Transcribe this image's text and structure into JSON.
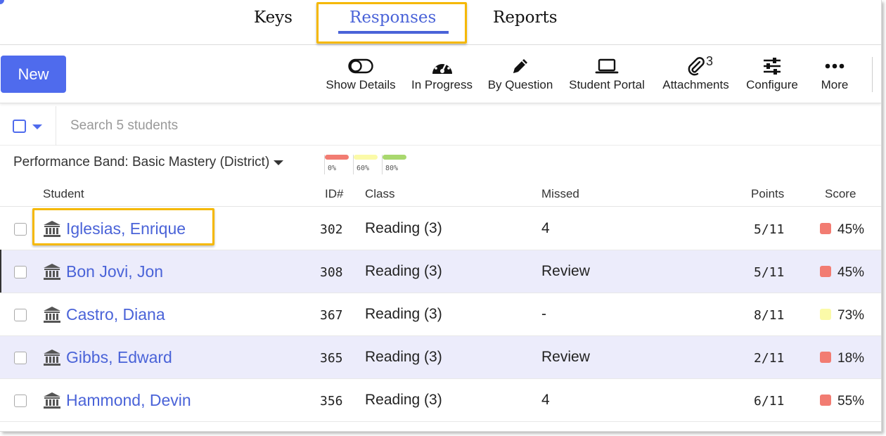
{
  "tabs": [
    {
      "label": "Keys"
    },
    {
      "label": "Responses",
      "active": true
    },
    {
      "label": "Reports"
    }
  ],
  "toolbar": {
    "new_label": "New",
    "tools": [
      {
        "label": "Show Details",
        "icon": "toggle-icon"
      },
      {
        "label": "In Progress",
        "icon": "speedometer-icon"
      },
      {
        "label": "By Question",
        "icon": "pencil-icon"
      },
      {
        "label": "Student Portal",
        "icon": "laptop-icon"
      },
      {
        "label": "Attachments",
        "icon": "paperclip-icon",
        "count": "3"
      },
      {
        "label": "Configure",
        "icon": "sliders-icon"
      },
      {
        "label": "More",
        "icon": "more-dots-icon"
      }
    ]
  },
  "search": {
    "placeholder": "Search 5 students"
  },
  "band": {
    "label": "Performance Band: Basic Mastery (District)",
    "levels": [
      {
        "label": "0%",
        "color": "#f27c72"
      },
      {
        "label": "60%",
        "color": "#fbfaa8"
      },
      {
        "label": "80%",
        "color": "#a9d86e"
      }
    ]
  },
  "table": {
    "headers": {
      "student": "Student",
      "id": "ID#",
      "class": "Class",
      "missed": "Missed",
      "points": "Points",
      "score": "Score"
    },
    "rows": [
      {
        "name": "Iglesias, Enrique",
        "id": "302",
        "class": "Reading (3)",
        "missed": "4",
        "points": "5/11",
        "score": "45%",
        "color": "#f27c72"
      },
      {
        "name": "Bon Jovi, Jon",
        "id": "308",
        "class": "Reading (3)",
        "missed": "Review",
        "points": "5/11",
        "score": "45%",
        "color": "#f27c72"
      },
      {
        "name": "Castro, Diana",
        "id": "367",
        "class": "Reading (3)",
        "missed": "-",
        "points": "8/11",
        "score": "73%",
        "color": "#fbfaa8"
      },
      {
        "name": "Gibbs, Edward",
        "id": "365",
        "class": "Reading (3)",
        "missed": "Review",
        "points": "2/11",
        "score": "18%",
        "color": "#f27c72"
      },
      {
        "name": "Hammond, Devin",
        "id": "356",
        "class": "Reading (3)",
        "missed": "4",
        "points": "6/11",
        "score": "55%",
        "color": "#f27c72"
      }
    ]
  },
  "colors": {
    "accent": "#4f6bed",
    "highlight": "#f5b800",
    "row_alt": "#ececfb"
  }
}
